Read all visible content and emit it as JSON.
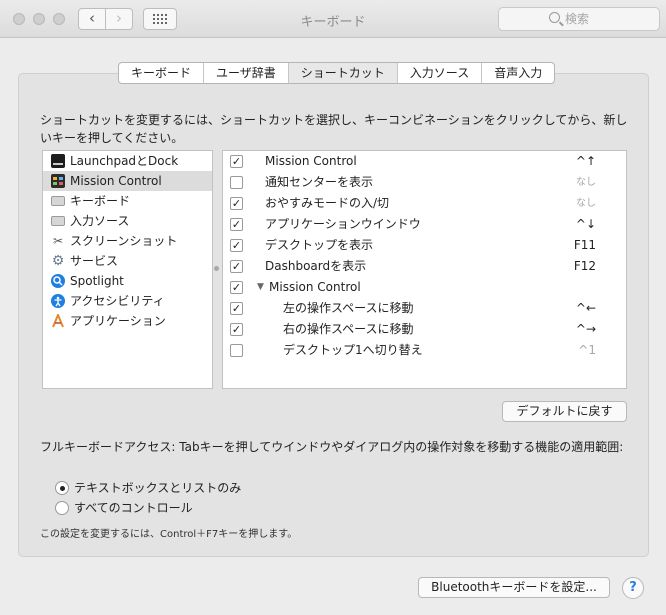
{
  "window": {
    "title": "キーボード",
    "search_placeholder": "検索",
    "nav_back": "‹",
    "nav_forward": "›",
    "grid_icon": "grid-icon"
  },
  "tabs": [
    {
      "label": "キーボード"
    },
    {
      "label": "ユーザ辞書"
    },
    {
      "label": "ショートカット",
      "selected": true
    },
    {
      "label": "入力ソース"
    },
    {
      "label": "音声入力"
    }
  ],
  "description": "ショートカットを変更するには、ショートカットを選択し、キーコンビネーションをクリックしてから、新しいキーを押してください。",
  "categories": [
    {
      "label": "LaunchpadとDock",
      "icon": "launchpad-dock-icon"
    },
    {
      "label": "Mission Control",
      "icon": "mission-control-icon",
      "selected": true
    },
    {
      "label": "キーボード",
      "icon": "keyboard-icon"
    },
    {
      "label": "入力ソース",
      "icon": "input-sources-icon"
    },
    {
      "label": "スクリーンショット",
      "icon": "screenshot-icon"
    },
    {
      "label": "サービス",
      "icon": "services-gear-icon"
    },
    {
      "label": "Spotlight",
      "icon": "spotlight-icon"
    },
    {
      "label": "アクセシビリティ",
      "icon": "accessibility-icon"
    },
    {
      "label": "アプリケーション",
      "icon": "app-shortcuts-icon"
    }
  ],
  "shortcuts": [
    {
      "label": "Mission Control",
      "key": "^↑",
      "checked": true,
      "indent": 0
    },
    {
      "label": "通知センターを表示",
      "key": "なし",
      "checked": false,
      "indent": 0,
      "dim": true
    },
    {
      "label": "おやすみモードの入/切",
      "key": "なし",
      "checked": true,
      "indent": 0,
      "dim": true
    },
    {
      "label": "アプリケーションウインドウ",
      "key": "^↓",
      "checked": true,
      "indent": 0
    },
    {
      "label": "デスクトップを表示",
      "key": "F11",
      "checked": true,
      "indent": 0
    },
    {
      "label": "Dashboardを表示",
      "key": "F12",
      "checked": true,
      "indent": 0
    },
    {
      "label": "Mission Control",
      "key": "",
      "checked": true,
      "indent": 0,
      "group": true
    },
    {
      "label": "左の操作スペースに移動",
      "key": "^←",
      "checked": true,
      "indent": 1
    },
    {
      "label": "右の操作スペースに移動",
      "key": "^→",
      "checked": true,
      "indent": 1
    },
    {
      "label": "デスクトップ1へ切り替え",
      "key": "^1",
      "checked": false,
      "indent": 1,
      "dim": true
    }
  ],
  "disclosure_glyph": "▼",
  "check_glyph": "✓",
  "restore_defaults": "デフォルトに戻す",
  "full_keyboard_access": "フルキーボードアクセス: Tabキーを押してウインドウやダイアログ内の操作対象を移動する機能の適用範囲:",
  "radio_options": [
    {
      "label": "テキストボックスとリストのみ",
      "selected": true
    },
    {
      "label": "すべてのコントロール",
      "selected": false
    }
  ],
  "note": "この設定を変更するには、Control＋F7キーを押します。",
  "bluetooth_button": "Bluetoothキーボードを設定...",
  "help_glyph": "?",
  "colors": {
    "accent": "#2a7fe0",
    "selected_row": "#dcdcdc",
    "dim_text": "#a8a8a8"
  }
}
